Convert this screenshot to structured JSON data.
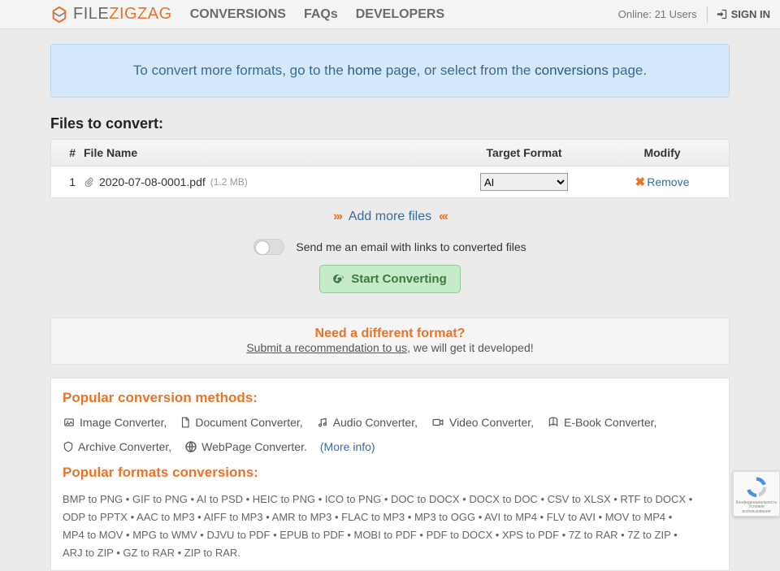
{
  "header": {
    "logo_file": "FILE",
    "logo_zigzag": "ZIGZAG",
    "nav": {
      "conversions": "CONVERSIONS",
      "faqs": "FAQs",
      "developers": "DEVELOPERS"
    },
    "online": "Online: 21 Users",
    "signin": "SIGN IN"
  },
  "notice": {
    "p1": "To convert more formats, go to the ",
    "link1": "home",
    "p2": " page, or select from the ",
    "link2": "conversions",
    "p3": " page."
  },
  "files": {
    "heading": "Files to convert:",
    "cols": {
      "idx": "#",
      "name": "File Name",
      "target": "Target Format",
      "modify": "Modify"
    },
    "rows": [
      {
        "idx": "1",
        "name": "2020-07-08-0001.pdf",
        "size": "(1.2 MB)",
        "format": "AI",
        "remove": "Remove"
      }
    ],
    "addmore": "Add more files"
  },
  "email": {
    "label": "Send me an email with links to converted files"
  },
  "start": {
    "label": "Start Converting"
  },
  "need": {
    "title": "Need a different format?",
    "link": "Submit a recommendation to us",
    "rest": ", we will get it developed!"
  },
  "popular": {
    "title": "Popular conversion methods:",
    "items": [
      "Image Converter",
      "Document Converter",
      "Audio Converter",
      "Video Converter",
      "E-Book Converter",
      "Archive Converter",
      "WebPage Converter"
    ],
    "more": "(More info)"
  },
  "formats": {
    "title": "Popular formats conversions:",
    "list": [
      "BMP to PNG",
      "GIF to PNG",
      "AI to PSD",
      "HEIC to PNG",
      "ICO to PNG",
      "DOC to DOCX",
      "DOCX to DOC",
      "CSV to XLSX",
      "RTF to DOCX",
      "ODP to PPTX",
      "AAC to MP3",
      "AIFF to MP3",
      "AMR to MP3",
      "FLAC to MP3",
      "MP3 to OGG",
      "AVI to MP4",
      "FLV to AVI",
      "MOV to MP4",
      "MP4 to MOV",
      "MPG to WMV",
      "DJVU to PDF",
      "EPUB to PDF",
      "MOBI to PDF",
      "PDF to DOCX",
      "XPS to PDF",
      "7Z to RAR",
      "7Z to ZIP",
      "ARJ to ZIP",
      "GZ to RAR",
      "ZIP to RAR"
    ]
  }
}
